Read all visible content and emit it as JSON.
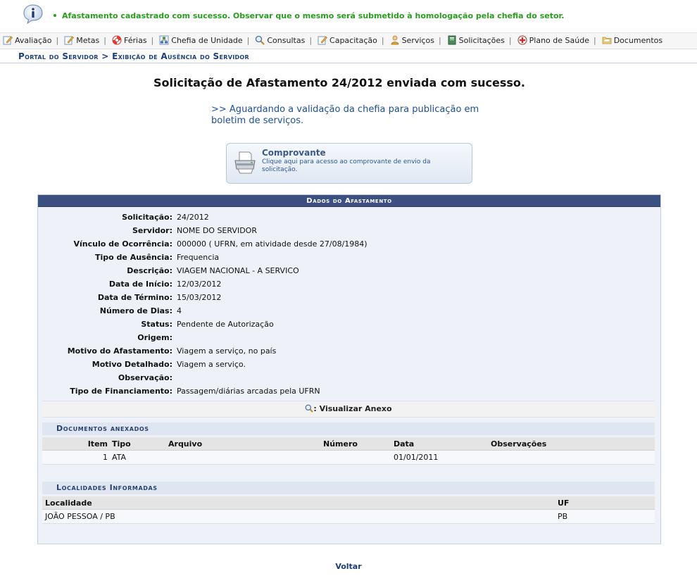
{
  "message": {
    "text": "Afastamento cadastrado com sucesso. Observar que o mesmo será submetido à homologação pela chefia do setor.",
    "icon": "info-icon",
    "color": "#2a9b1f"
  },
  "menu": [
    {
      "label": "Avaliação",
      "icon": "pencil-icon"
    },
    {
      "label": "Metas",
      "icon": "pencil-icon"
    },
    {
      "label": "Férias",
      "icon": "lifebuoy-icon"
    },
    {
      "label": "Chefia de Unidade",
      "icon": "org-chart-icon"
    },
    {
      "label": "Consultas",
      "icon": "magnifier-icon"
    },
    {
      "label": "Capacitação",
      "icon": "pencil-icon"
    },
    {
      "label": "Serviços",
      "icon": "person-icon"
    },
    {
      "label": "Solicitações",
      "icon": "book-icon"
    },
    {
      "label": "Plano de Saúde",
      "icon": "medical-icon"
    },
    {
      "label": "Documentos",
      "icon": "folder-icon"
    }
  ],
  "breadcrumb": "Portal do Servidor > Exibição de Ausência do Servidor",
  "title": "Solicitação de Afastamento 24/2012 enviada com sucesso.",
  "waiting_text": ">> Aguardando a validação da chefia para publicação em boletim de serviços.",
  "comprovante": {
    "title": "Comprovante",
    "description": "Clique aqui para acesso ao comprovante de envio da solicitação."
  },
  "panel": {
    "title": "Dados do Afastamento",
    "fields": [
      {
        "label": "Solicitação:",
        "value": "24/2012"
      },
      {
        "label": "Servidor:",
        "value": "NOME DO SERVIDOR"
      },
      {
        "label": "Vínculo de Ocorrência:",
        "value": "000000 ( UFRN, em atividade desde 27/08/1984)"
      },
      {
        "label": "Tipo de Ausência:",
        "value": "Frequencia"
      },
      {
        "label": "Descrição:",
        "value": "VIAGEM NACIONAL - A SERVICO"
      },
      {
        "label": "Data de Início:",
        "value": "12/03/2012"
      },
      {
        "label": "Data de Término:",
        "value": "15/03/2012"
      },
      {
        "label": "Número de Dias:",
        "value": "4"
      },
      {
        "label": "Status:",
        "value": "Pendente de Autorização"
      },
      {
        "label": "Origem:",
        "value": ""
      },
      {
        "label": "Motivo do Afastamento:",
        "value": "Viagem a serviço, no país"
      },
      {
        "label": "Motivo Detalhado:",
        "value": "Viagem a serviço."
      },
      {
        "label": "Observação:",
        "value": ""
      },
      {
        "label": "Tipo de Financiamento:",
        "value": "Passagem/diárias arcadas pela UFRN"
      }
    ],
    "anexo_label": ": Visualizar Anexo",
    "documentos": {
      "title": "Documentos anexados",
      "headers": [
        "Item",
        "Tipo",
        "Arquivo",
        "Número",
        "Data",
        "Observações"
      ],
      "rows": [
        {
          "item": "1",
          "tipo": "ATA",
          "arquivo": "",
          "numero": "",
          "data": "01/01/2011",
          "obs": ""
        }
      ]
    },
    "localidades": {
      "title": "Localidades Informadas",
      "headers": [
        "Localidade",
        "UF"
      ],
      "rows": [
        {
          "localidade": "JOÃO PESSOA / PB",
          "uf": "PB"
        }
      ]
    }
  },
  "voltar": "Voltar"
}
